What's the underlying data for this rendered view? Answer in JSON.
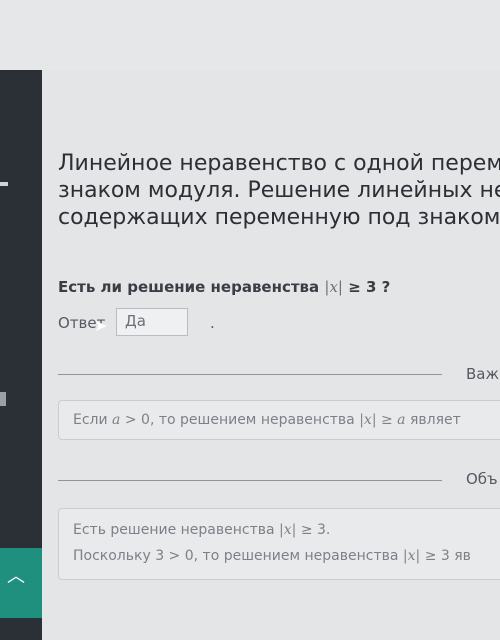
{
  "title": {
    "line1": "Линейное неравенство с одной перем",
    "line2": "знаком модуля. Решение линейных не",
    "line3": "содержащих переменную под знаком"
  },
  "question": {
    "prefix": "Есть ли решение неравенства ",
    "expr": "|x|",
    "suffix": " ≥ 3 ?"
  },
  "answer": {
    "label": "Ответ",
    "value": "Да",
    "tail": "."
  },
  "section1": {
    "label": "Важ"
  },
  "hint1": {
    "prefix": "Если ",
    "var": "a",
    "mid": " > 0, то решением неравенства ",
    "expr": "|x| ≥ a",
    "suffix": " являет"
  },
  "section2": {
    "label": "Объ"
  },
  "hint2": {
    "line1_prefix": "Есть решение неравенства ",
    "line1_expr": "|x|",
    "line1_suffix": " ≥ 3.",
    "line2_prefix": "Поскольку 3 > 0, то решением неравенства ",
    "line2_expr": "|x|",
    "line2_suffix": " ≥ 3 яв"
  },
  "colors": {
    "sidebar": "#2b2f36",
    "accent": "#1f8f7e"
  },
  "icons": {
    "sidebar_toggle": "chevron-up-icon",
    "cursor": "mouse-pointer-icon"
  }
}
